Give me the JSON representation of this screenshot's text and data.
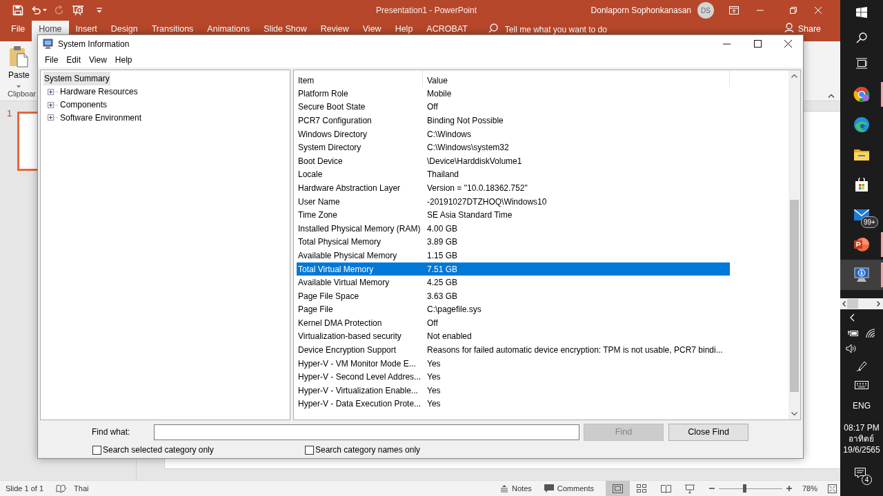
{
  "powerpoint": {
    "quick_access": [
      {
        "kind": "save",
        "disabled": false
      },
      {
        "kind": "undo",
        "disabled": false
      },
      {
        "kind": "redo",
        "disabled": true
      },
      {
        "kind": "slideshow",
        "disabled": false
      }
    ],
    "title": "Presentation1 - PowerPoint",
    "user_name": "Donlaporn Sophonkanasan",
    "avatar_initials": "DS",
    "tabs": [
      {
        "label": "File",
        "selected": false
      },
      {
        "label": "Home",
        "selected": true
      },
      {
        "label": "Insert",
        "selected": false
      },
      {
        "label": "Design",
        "selected": false
      },
      {
        "label": "Transitions",
        "selected": false
      },
      {
        "label": "Animations",
        "selected": false
      },
      {
        "label": "Slide Show",
        "selected": false
      },
      {
        "label": "Review",
        "selected": false
      },
      {
        "label": "View",
        "selected": false
      },
      {
        "label": "Help",
        "selected": false
      },
      {
        "label": "ACROBAT",
        "selected": false
      }
    ],
    "tell_me": "Tell me what you want to do",
    "share": "Share",
    "paste": "Paste",
    "group_label": "Clipboar",
    "slide_number": "1",
    "status": {
      "slide": "Slide 1 of 1",
      "language": "Thai",
      "notes": "Notes",
      "comments": "Comments",
      "views": [
        {
          "kind": "normal",
          "selected": true
        },
        {
          "kind": "sorter",
          "selected": false
        },
        {
          "kind": "reading",
          "selected": false
        },
        {
          "kind": "slideshow",
          "selected": false
        }
      ],
      "level": 0.4,
      "zoom": "78%"
    }
  },
  "window": {
    "title": "System Information",
    "menu": [
      "File",
      "Edit",
      "View",
      "Help"
    ],
    "tree": [
      {
        "label": "System Summary",
        "selected": true,
        "children": [
          {
            "label": "Hardware Resources",
            "expanded": false
          },
          {
            "label": "Components",
            "expanded": false
          },
          {
            "label": "Software Environment",
            "expanded": false
          }
        ]
      }
    ],
    "columns": [
      "Item",
      "Value"
    ],
    "rows": [
      {
        "item": "Platform Role",
        "value": "Mobile",
        "selected": false
      },
      {
        "item": "Secure Boot State",
        "value": "Off",
        "selected": false
      },
      {
        "item": "PCR7 Configuration",
        "value": "Binding Not Possible",
        "selected": false
      },
      {
        "item": "Windows Directory",
        "value": "C:\\Windows",
        "selected": false
      },
      {
        "item": "System Directory",
        "value": "C:\\Windows\\system32",
        "selected": false
      },
      {
        "item": "Boot Device",
        "value": "\\Device\\HarddiskVolume1",
        "selected": false
      },
      {
        "item": "Locale",
        "value": "Thailand",
        "selected": false
      },
      {
        "item": "Hardware Abstraction Layer",
        "value": "Version = \"10.0.18362.752\"",
        "selected": false
      },
      {
        "item": "User Name",
        "value": "-20191027DTZHOQ\\Windows10",
        "selected": false
      },
      {
        "item": "Time Zone",
        "value": "SE Asia Standard Time",
        "selected": false
      },
      {
        "item": "Installed Physical Memory (RAM)",
        "value": "4.00 GB",
        "selected": false
      },
      {
        "item": "Total Physical Memory",
        "value": "3.89 GB",
        "selected": false
      },
      {
        "item": "Available Physical Memory",
        "value": "1.15 GB",
        "selected": false
      },
      {
        "item": "Total Virtual Memory",
        "value": "7.51 GB",
        "selected": true
      },
      {
        "item": "Available Virtual Memory",
        "value": "4.25 GB",
        "selected": false
      },
      {
        "item": "Page File Space",
        "value": "3.63 GB",
        "selected": false
      },
      {
        "item": "Page File",
        "value": "C:\\pagefile.sys",
        "selected": false
      },
      {
        "item": "Kernel DMA Protection",
        "value": "Off",
        "selected": false
      },
      {
        "item": "Virtualization-based security",
        "value": "Not enabled",
        "selected": false
      },
      {
        "item": "Device Encryption Support",
        "value": "Reasons for failed automatic device encryption: TPM is not usable, PCR7 bindi...",
        "selected": false
      },
      {
        "item": "Hyper-V - VM Monitor Mode E...",
        "value": "Yes",
        "selected": false
      },
      {
        "item": "Hyper-V - Second Level Addres...",
        "value": "Yes",
        "selected": false
      },
      {
        "item": "Hyper-V - Virtualization Enable...",
        "value": "Yes",
        "selected": false
      },
      {
        "item": "Hyper-V - Data Execution Prote...",
        "value": "Yes",
        "selected": false
      }
    ],
    "find": {
      "label": "Find what:",
      "find_button": "Find",
      "find_disabled": true,
      "close_button": "Close Find",
      "options": [
        {
          "label": "Search selected category only",
          "checked": false
        },
        {
          "label": "Search category names only",
          "checked": false
        }
      ]
    }
  },
  "taskbar": {
    "apps": [
      {
        "kind": "chrome",
        "running": true,
        "selected": false
      },
      {
        "kind": "edge",
        "running": false,
        "selected": false
      },
      {
        "kind": "folder",
        "running": false,
        "selected": false
      },
      {
        "kind": "store",
        "running": false,
        "selected": false
      },
      {
        "kind": "mail",
        "running": false,
        "selected": false,
        "badge": "99+"
      },
      {
        "kind": "powerpoint",
        "running": true,
        "selected": false
      },
      {
        "kind": "sysinfo",
        "running": true,
        "selected": true
      }
    ],
    "language": "ENG",
    "time": "08:17 PM",
    "day": "อาทิตย์",
    "date": "19/6/2565",
    "notifications": "4"
  }
}
